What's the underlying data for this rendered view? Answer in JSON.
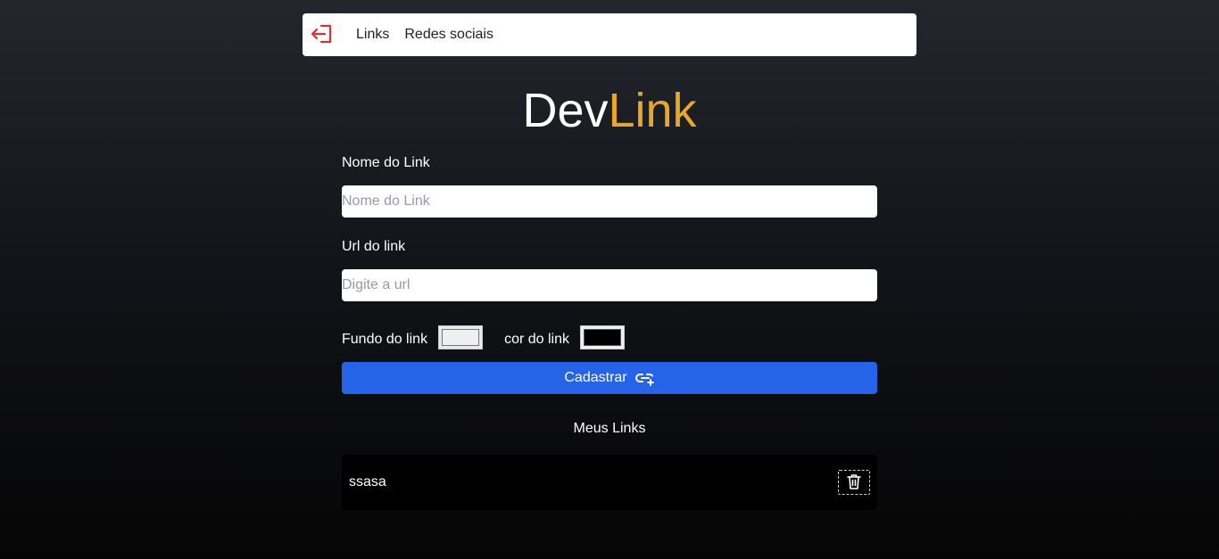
{
  "header": {
    "logout_icon": "logout-icon",
    "nav": [
      {
        "label": "Links"
      },
      {
        "label": "Redes sociais"
      }
    ]
  },
  "logo": {
    "part1": "Dev",
    "part2": "Link",
    "colors": {
      "dev": "#ffffff",
      "link": "#e7a825"
    }
  },
  "form": {
    "name_label": "Nome do Link",
    "name_value": "",
    "name_placeholder": "Nome do Link",
    "url_label": "Url do link",
    "url_value": "",
    "url_placeholder": "Digite a url",
    "bg_color_label": "Fundo do link",
    "bg_color_value": "#efefef",
    "text_color_label": "cor do link",
    "text_color_value": "#000000",
    "submit_label": "Cadastrar",
    "submit_icon": "link-add-icon",
    "accent": "#2563e9"
  },
  "links": {
    "title": "Meus Links",
    "items": [
      {
        "name": "ssasa",
        "delete_icon": "trash-icon"
      }
    ]
  }
}
